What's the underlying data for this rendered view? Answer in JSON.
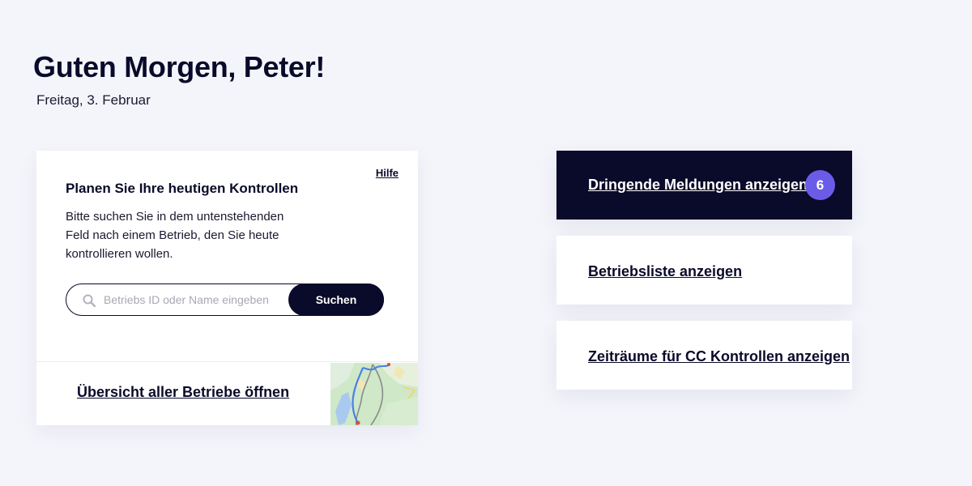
{
  "header": {
    "greeting": "Guten Morgen, Peter!",
    "date": "Freitag, 3. Februar"
  },
  "plan_card": {
    "help_label": "Hilfe",
    "title": "Planen Sie Ihre heutigen Kontrollen",
    "description": "Bitte suchen Sie in dem untenstehenden Feld nach einem Betrieb, den Sie heute kontrollieren wollen.",
    "search": {
      "placeholder": "Betriebs ID oder Name eingeben",
      "value": "",
      "icon": "search-icon",
      "button_label": "Suchen"
    },
    "overview_link": "Übersicht aller Betriebe öffnen",
    "map_icon": "map-thumbnail"
  },
  "actions": {
    "urgent": {
      "label": "Dringende Meldungen anzeigen",
      "badge_count": "6"
    },
    "business_list": {
      "label": "Betriebsliste anzeigen"
    },
    "cc_periods": {
      "label": "Zeiträume für CC Kontrollen anzeigen"
    }
  },
  "colors": {
    "background": "#f4f5fb",
    "primary_dark": "#0a0a2a",
    "badge": "#6b5ce7",
    "card": "#ffffff"
  }
}
